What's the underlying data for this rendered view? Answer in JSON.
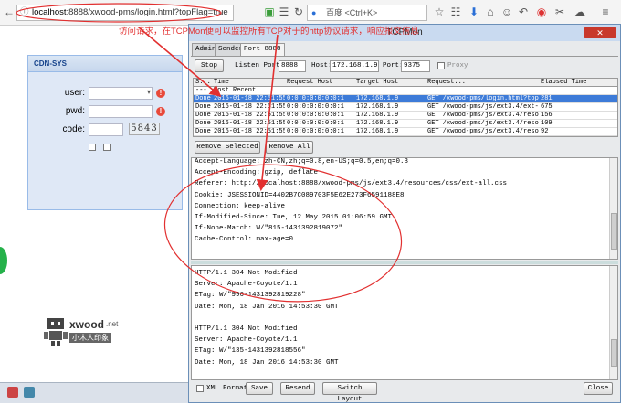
{
  "browser": {
    "url_host": "localhost",
    "url_rest": ":8888/xwood-pms/login.html?topFlag=true",
    "search_placeholder": "百度 <Ctrl+K>"
  },
  "annotation": {
    "text": "访问请求，在TCPMon便可以监控所有TCP对于的http协议请求，响应报文信息",
    "color": "#e23030"
  },
  "login": {
    "title": "CDN-SYS",
    "user_label": "user:",
    "pwd_label": "pwd:",
    "code_label": "code:",
    "captcha": "5843"
  },
  "logo": {
    "brand": "xwood",
    "suffix": ".net",
    "subtitle": "小木人印象"
  },
  "tcpmon": {
    "title": "TCPMon",
    "tabs": [
      "Admin",
      "Sender",
      "Port 8888"
    ],
    "stop_label": "Stop",
    "listen_port_label": "Listen Port:",
    "listen_port": "8888",
    "host_label": "Host:",
    "host": "172.168.1.9",
    "port_label": "Port:",
    "port": "9375",
    "proxy_label": "Proxy",
    "columns": [
      "S...",
      "Time",
      "Request Host",
      "Target Host",
      "Request...",
      "Elapsed Time"
    ],
    "most_recent": "Most Recent",
    "rows": [
      {
        "state": "Done",
        "time": "2016-01-18 22:51:55",
        "req_host": "0:0:0:0:0:0:0:1",
        "target": "172.168.1.9",
        "request": "GET /xwood-pms/login.html?top...",
        "elapsed": "281"
      },
      {
        "state": "Done",
        "time": "2016-01-18 22:51:55",
        "req_host": "0:0:0:0:0:0:0:1",
        "target": "172.168.1.9",
        "request": "GET /xwood-pms/js/ext3.4/ext-a...",
        "elapsed": "675"
      },
      {
        "state": "Done",
        "time": "2016-01-18 22:51:55",
        "req_host": "0:0:0:0:0:0:0:1",
        "target": "172.168.1.9",
        "request": "GET /xwood-pms/js/ext3.4/resou...",
        "elapsed": "156"
      },
      {
        "state": "Done",
        "time": "2016-01-18 22:51:55",
        "req_host": "0:0:0:0:0:0:0:1",
        "target": "172.168.1.9",
        "request": "GET /xwood-pms/js/ext3.4/resou...",
        "elapsed": "109"
      },
      {
        "state": "Done",
        "time": "2016-01-18 22:51:55",
        "req_host": "0:0:0:0:0:0:0:1",
        "target": "172.168.1.9",
        "request": "GET /xwood-pms/js/ext3.4/resou...",
        "elapsed": "92"
      }
    ],
    "remove_selected": "Remove Selected",
    "remove_all": "Remove All",
    "request_lines": [
      "Accept-Language: zh-CN,zh;q=0.8,en-US;q=0.5,en;q=0.3",
      "Accept-Encoding: gzip, deflate",
      "Referer: http://localhost:8888/xwood-pms/js/ext3.4/resources/css/ext-all.css",
      "Cookie: JSESSIONID=4402B7C089703F5E62E273F6591188E8",
      "Connection: keep-alive",
      "If-Modified-Since: Tue, 12 May 2015 01:06:59 GMT",
      "If-None-Match: W/\"815-1431392819072\"",
      "Cache-Control: max-age=0"
    ],
    "response_lines": [
      "HTTP/1.1 304 Not Modified",
      "Server: Apache-Coyote/1.1",
      "ETag: W/\"996-1431392819228\"",
      "Date: Mon, 18 Jan 2016 14:53:30 GMT",
      "",
      "HTTP/1.1 304 Not Modified",
      "Server: Apache-Coyote/1.1",
      "ETag: W/\"135-1431392818556\"",
      "Date: Mon, 18 Jan 2016 14:53:30 GMT"
    ],
    "xml_format_label": "XML Format",
    "save_label": "Save",
    "resend_label": "Resend",
    "switch_layout_label": "Switch Layout",
    "close_label": "Close"
  }
}
